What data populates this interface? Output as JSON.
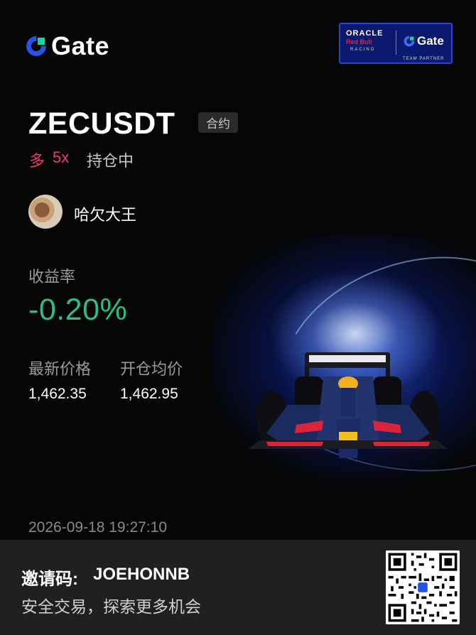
{
  "brand": {
    "logo_text": "Gate",
    "partner": {
      "oracle": "ORACLE",
      "redbull": "Red Bull",
      "racing": "RACING",
      "gate": "Gate",
      "team": "TEAM PARTNER"
    },
    "accent": "#2354e6"
  },
  "position": {
    "symbol": "ZECUSDT",
    "type_badge": "合约",
    "side": "多",
    "leverage": "5x",
    "status": "持仓中",
    "side_color": "#f0386b"
  },
  "user": {
    "name": "哈欠大王"
  },
  "pnl": {
    "label": "收益率",
    "value": "-0.20%",
    "color": "#2ebd85"
  },
  "prices": {
    "latest_label": "最新价格",
    "latest_value": "1,462.35",
    "entry_label": "开仓均价",
    "entry_value": "1,462.95"
  },
  "timestamp": "2026-09-18 19:27:10",
  "footer": {
    "invite_label": "邀请码:",
    "invite_code": "JOEHONNB",
    "slogan": "安全交易，探索更多机会"
  }
}
